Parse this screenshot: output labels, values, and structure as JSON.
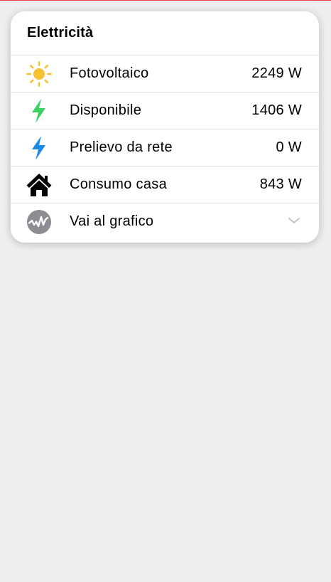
{
  "card": {
    "title": "Elettricità",
    "rows": [
      {
        "icon": "sun-icon",
        "label": "Fotovoltaico",
        "value": "2249 W"
      },
      {
        "icon": "lightning-green-icon",
        "label": "Disponibile",
        "value": "1406 W"
      },
      {
        "icon": "lightning-blue-icon",
        "label": "Prelievo da rete",
        "value": "0 W"
      },
      {
        "icon": "house-icon",
        "label": "Consumo casa",
        "value": "843 W"
      }
    ],
    "chart_link": {
      "icon": "chart-wave-icon",
      "label": "Vai al grafico"
    }
  },
  "colors": {
    "sun": "#f7c131",
    "lightning_green": "#3dd164",
    "lightning_blue": "#1a8ae6",
    "house": "#000000",
    "chart_icon_bg": "#8c8c92",
    "chevron": "#c4c4c8",
    "top_accent": "#e0443a"
  }
}
